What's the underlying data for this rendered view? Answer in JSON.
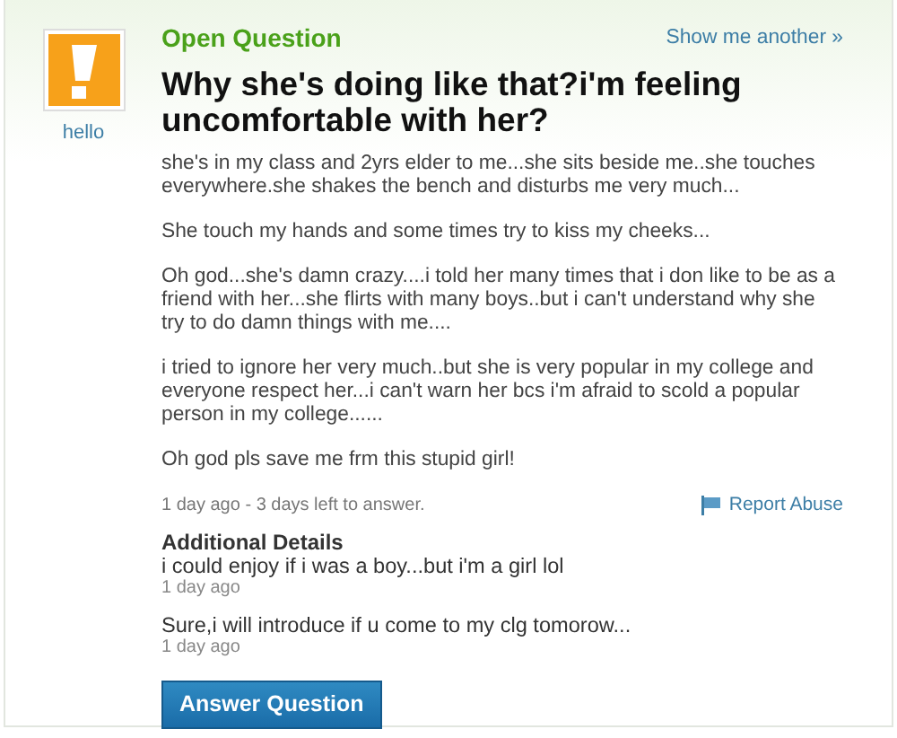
{
  "avatar": {
    "name": "hello"
  },
  "status": "Open Question",
  "show_another": "Show me another »",
  "title": "Why she's doing like that?i'm feeling uncomfortable with her?",
  "paragraphs": [
    "she's in my class and 2yrs elder to me...she sits beside me..she touches everywhere.she shakes the bench and disturbs me very much...",
    "She touch my hands and some times try to kiss my cheeks...",
    "Oh god...she's damn crazy....i told her many times that i don like to be as a friend with her...she flirts with many boys..but i can't understand why she try to do damn things with me....",
    "i tried to ignore her very much..but she is very popular in my college and everyone respect her...i can't warn her bcs i'm afraid to scold a popular person in my college......",
    "Oh god pls save me frm this stupid girl!"
  ],
  "meta": "1 day ago - 3 days left to answer.",
  "report_link": "Report Abuse",
  "additional_details": {
    "heading": "Additional Details",
    "entries": [
      {
        "text": "i could enjoy if i was a boy...but i'm a girl lol",
        "time": "1 day ago"
      },
      {
        "text": "Sure,i will introduce if u come to my clg tomorow...",
        "time": "1 day ago"
      }
    ]
  },
  "answer_button": "Answer Question"
}
